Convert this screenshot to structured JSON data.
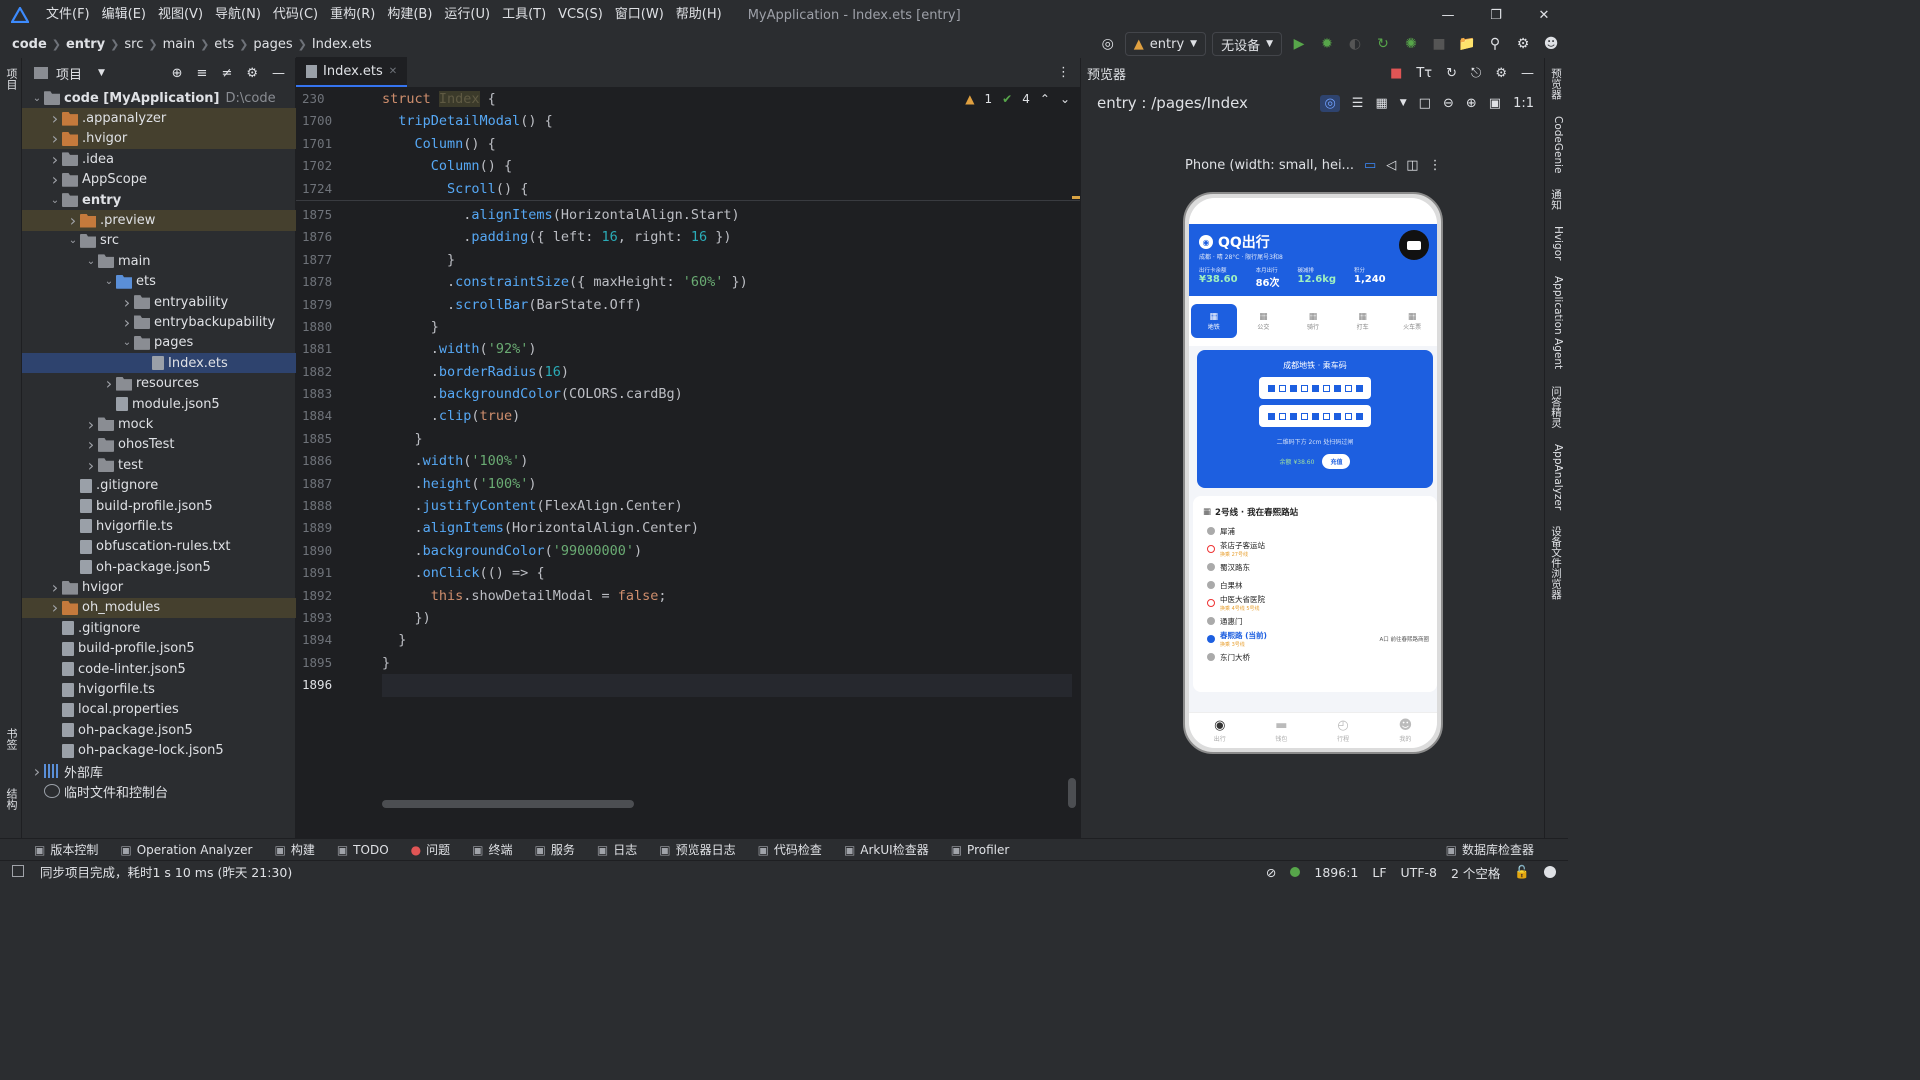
{
  "menubar": {
    "items": [
      "文件(F)",
      "编辑(E)",
      "视图(V)",
      "导航(N)",
      "代码(C)",
      "重构(R)",
      "构建(B)",
      "运行(U)",
      "工具(T)",
      "VCS(S)",
      "窗口(W)",
      "帮助(H)"
    ],
    "title": "MyApplication - Index.ets [entry]"
  },
  "breadcrumb": [
    "code",
    "entry",
    "src",
    "main",
    "ets",
    "pages",
    "Index.ets"
  ],
  "toolbar": {
    "run_config": "entry",
    "device": "无设备"
  },
  "left_strip": {
    "project": "项目",
    "bookmarks": "书签",
    "structure": "结构"
  },
  "project_panel": {
    "title": "项目",
    "tree": [
      {
        "depth": 0,
        "arrow": "down",
        "icon": "folder",
        "label": "code [MyApplication]",
        "extra": "D:\\code",
        "bold": true
      },
      {
        "depth": 1,
        "arrow": "right",
        "icon": "folder-orange",
        "label": ".appanalyzer",
        "hl": true
      },
      {
        "depth": 1,
        "arrow": "right",
        "icon": "folder-orange",
        "label": ".hvigor",
        "hl": true
      },
      {
        "depth": 1,
        "arrow": "right",
        "icon": "folder",
        "label": ".idea"
      },
      {
        "depth": 1,
        "arrow": "right",
        "icon": "folder",
        "label": "AppScope"
      },
      {
        "depth": 1,
        "arrow": "down",
        "icon": "folder",
        "label": "entry",
        "bold": true
      },
      {
        "depth": 2,
        "arrow": "right",
        "icon": "folder-orange",
        "label": ".preview",
        "hl": true
      },
      {
        "depth": 2,
        "arrow": "down",
        "icon": "folder",
        "label": "src"
      },
      {
        "depth": 3,
        "arrow": "down",
        "icon": "folder",
        "label": "main"
      },
      {
        "depth": 4,
        "arrow": "down",
        "icon": "folder-blue",
        "label": "ets"
      },
      {
        "depth": 5,
        "arrow": "right",
        "icon": "folder",
        "label": "entryability"
      },
      {
        "depth": 5,
        "arrow": "right",
        "icon": "folder",
        "label": "entrybackupability"
      },
      {
        "depth": 5,
        "arrow": "down",
        "icon": "folder",
        "label": "pages"
      },
      {
        "depth": 6,
        "arrow": "",
        "icon": "file",
        "label": "Index.ets",
        "sel": true
      },
      {
        "depth": 4,
        "arrow": "right",
        "icon": "folder",
        "label": "resources"
      },
      {
        "depth": 4,
        "arrow": "",
        "icon": "file",
        "label": "module.json5"
      },
      {
        "depth": 3,
        "arrow": "right",
        "icon": "folder",
        "label": "mock"
      },
      {
        "depth": 3,
        "arrow": "right",
        "icon": "folder",
        "label": "ohosTest"
      },
      {
        "depth": 3,
        "arrow": "right",
        "icon": "folder",
        "label": "test"
      },
      {
        "depth": 2,
        "arrow": "",
        "icon": "file",
        "label": ".gitignore"
      },
      {
        "depth": 2,
        "arrow": "",
        "icon": "file",
        "label": "build-profile.json5"
      },
      {
        "depth": 2,
        "arrow": "",
        "icon": "file",
        "label": "hvigorfile.ts"
      },
      {
        "depth": 2,
        "arrow": "",
        "icon": "file",
        "label": "obfuscation-rules.txt"
      },
      {
        "depth": 2,
        "arrow": "",
        "icon": "file",
        "label": "oh-package.json5"
      },
      {
        "depth": 1,
        "arrow": "right",
        "icon": "folder",
        "label": "hvigor"
      },
      {
        "depth": 1,
        "arrow": "right",
        "icon": "folder-orange",
        "label": "oh_modules",
        "hl": true
      },
      {
        "depth": 1,
        "arrow": "",
        "icon": "file",
        "label": ".gitignore"
      },
      {
        "depth": 1,
        "arrow": "",
        "icon": "file",
        "label": "build-profile.json5"
      },
      {
        "depth": 1,
        "arrow": "",
        "icon": "file",
        "label": "code-linter.json5"
      },
      {
        "depth": 1,
        "arrow": "",
        "icon": "file",
        "label": "hvigorfile.ts"
      },
      {
        "depth": 1,
        "arrow": "",
        "icon": "file",
        "label": "local.properties"
      },
      {
        "depth": 1,
        "arrow": "",
        "icon": "file",
        "label": "oh-package.json5"
      },
      {
        "depth": 1,
        "arrow": "",
        "icon": "file",
        "label": "oh-package-lock.json5"
      },
      {
        "depth": 0,
        "arrow": "right",
        "icon": "lib",
        "label": "外部库"
      },
      {
        "depth": 0,
        "arrow": "",
        "icon": "scratch",
        "label": "临时文件和控制台"
      }
    ]
  },
  "editor": {
    "tab": "Index.ets",
    "inspections": {
      "warnings": "1",
      "ok": "4"
    },
    "lines": [
      {
        "n": "230",
        "code": [
          [
            "kw",
            "struct "
          ],
          [
            "cls",
            "Index"
          ],
          [
            "punc",
            " {"
          ]
        ]
      },
      {
        "n": "1700",
        "code": [
          [
            "punc",
            "  "
          ],
          [
            "fn",
            "tripDetailModal"
          ],
          [
            "punc",
            "() {"
          ]
        ]
      },
      {
        "n": "1701",
        "code": [
          [
            "punc",
            "    "
          ],
          [
            "fn",
            "Column"
          ],
          [
            "punc",
            "() {"
          ]
        ]
      },
      {
        "n": "1702",
        "code": [
          [
            "punc",
            "      "
          ],
          [
            "fn",
            "Column"
          ],
          [
            "punc",
            "() {"
          ]
        ]
      },
      {
        "n": "1724",
        "code": [
          [
            "punc",
            "        "
          ],
          [
            "fn",
            "Scroll"
          ],
          [
            "punc",
            "() {"
          ]
        ]
      },
      {
        "n": "1875",
        "code": [
          [
            "punc",
            "          ."
          ],
          [
            "fn",
            "alignItems"
          ],
          [
            "punc",
            "(HorizontalAlign.Start)"
          ]
        ]
      },
      {
        "n": "1876",
        "code": [
          [
            "punc",
            "          ."
          ],
          [
            "fn",
            "padding"
          ],
          [
            "punc",
            "({ left: "
          ],
          [
            "num",
            "16"
          ],
          [
            "punc",
            ", right: "
          ],
          [
            "num",
            "16"
          ],
          [
            "punc",
            " })"
          ]
        ]
      },
      {
        "n": "1877",
        "code": [
          [
            "punc",
            "        }"
          ]
        ]
      },
      {
        "n": "1878",
        "code": [
          [
            "punc",
            "        ."
          ],
          [
            "fn",
            "constraintSize"
          ],
          [
            "punc",
            "({ maxHeight: "
          ],
          [
            "str",
            "'60%'"
          ],
          [
            "punc",
            " })"
          ]
        ]
      },
      {
        "n": "1879",
        "code": [
          [
            "punc",
            "        ."
          ],
          [
            "fn",
            "scrollBar"
          ],
          [
            "punc",
            "(BarState.Off)"
          ]
        ]
      },
      {
        "n": "1880",
        "code": [
          [
            "punc",
            "      }"
          ]
        ]
      },
      {
        "n": "1881",
        "code": [
          [
            "punc",
            "      ."
          ],
          [
            "fn",
            "width"
          ],
          [
            "punc",
            "("
          ],
          [
            "str",
            "'92%'"
          ],
          [
            "punc",
            ")"
          ]
        ]
      },
      {
        "n": "1882",
        "code": [
          [
            "punc",
            "      ."
          ],
          [
            "fn",
            "borderRadius"
          ],
          [
            "punc",
            "("
          ],
          [
            "num",
            "16"
          ],
          [
            "punc",
            ")"
          ]
        ]
      },
      {
        "n": "1883",
        "code": [
          [
            "punc",
            "      ."
          ],
          [
            "fn",
            "backgroundColor"
          ],
          [
            "punc",
            "(COLORS.cardBg)"
          ]
        ]
      },
      {
        "n": "1884",
        "code": [
          [
            "punc",
            "      ."
          ],
          [
            "fn",
            "clip"
          ],
          [
            "punc",
            "("
          ],
          [
            "kw",
            "true"
          ],
          [
            "punc",
            ")"
          ]
        ]
      },
      {
        "n": "1885",
        "code": [
          [
            "punc",
            "    }"
          ]
        ]
      },
      {
        "n": "1886",
        "code": [
          [
            "punc",
            "    ."
          ],
          [
            "fn",
            "width"
          ],
          [
            "punc",
            "("
          ],
          [
            "str",
            "'100%'"
          ],
          [
            "punc",
            ")"
          ]
        ]
      },
      {
        "n": "1887",
        "code": [
          [
            "punc",
            "    ."
          ],
          [
            "fn",
            "height"
          ],
          [
            "punc",
            "("
          ],
          [
            "str",
            "'100%'"
          ],
          [
            "punc",
            ")"
          ]
        ]
      },
      {
        "n": "1888",
        "code": [
          [
            "punc",
            "    ."
          ],
          [
            "fn",
            "justifyContent"
          ],
          [
            "punc",
            "(FlexAlign.Center)"
          ]
        ]
      },
      {
        "n": "1889",
        "code": [
          [
            "punc",
            "    ."
          ],
          [
            "fn",
            "alignItems"
          ],
          [
            "punc",
            "(HorizontalAlign.Center)"
          ]
        ]
      },
      {
        "n": "1890",
        "code": [
          [
            "punc",
            "    ."
          ],
          [
            "fn",
            "backgroundColor"
          ],
          [
            "punc",
            "("
          ],
          [
            "str",
            "'99000000'"
          ],
          [
            "punc",
            ")"
          ]
        ]
      },
      {
        "n": "1891",
        "code": [
          [
            "punc",
            "    ."
          ],
          [
            "fn",
            "onClick"
          ],
          [
            "punc",
            "(() => {"
          ]
        ]
      },
      {
        "n": "1892",
        "code": [
          [
            "punc",
            "      "
          ],
          [
            "kw",
            "this"
          ],
          [
            "punc",
            ".showDetailModal = "
          ],
          [
            "kw",
            "false"
          ],
          [
            "punc",
            ";"
          ]
        ]
      },
      {
        "n": "1893",
        "code": [
          [
            "punc",
            "    })"
          ]
        ]
      },
      {
        "n": "1894",
        "code": [
          [
            "punc",
            "  }"
          ]
        ]
      },
      {
        "n": "1895",
        "code": [
          [
            "punc",
            "}"
          ]
        ]
      },
      {
        "n": "1896",
        "code": [],
        "current": true
      }
    ]
  },
  "previewer": {
    "title": "预览器",
    "path": "entry : /pages/Index",
    "device": "Phone (width: small, hei...",
    "app": {
      "name": "QQ出行",
      "sub": "成都 · 晴 28°C · 限行尾号3和8",
      "stats": [
        {
          "label": "出行卡余额",
          "value": "¥38.60"
        },
        {
          "label": "本月出行",
          "value": "86次"
        },
        {
          "label": "碳减排",
          "value": "12.6kg"
        },
        {
          "label": "积分",
          "value": "1,240"
        }
      ],
      "tabs": [
        "地铁",
        "公交",
        "骑行",
        "打车",
        "火车票"
      ],
      "card_title": "成都地铁 · 乘车码",
      "card_hint": "二维码下方 2cm 处扫码过闸",
      "card_balance": "余额 ¥38.60",
      "card_btn": "充值",
      "line_title": "2号线 · 我在春熙路站",
      "stations": [
        {
          "name": "犀浦",
          "type": "grey"
        },
        {
          "name": "茶店子客运站",
          "sub": "换乘 27号线",
          "type": "red"
        },
        {
          "name": "蜀汉路东",
          "type": "grey"
        },
        {
          "name": "白果林",
          "type": "grey"
        },
        {
          "name": "中医大省医院",
          "sub": "换乘 4号线 5号线",
          "type": "red"
        },
        {
          "name": "通惠门",
          "type": "grey"
        },
        {
          "name": "春熙路 (当前)",
          "sub": "换乘 3号线",
          "type": "blue",
          "right": "A口  前往春熙路商圈"
        },
        {
          "name": "东门大桥",
          "type": "grey"
        }
      ],
      "nav": [
        "出行",
        "钱包",
        "行程",
        "我的"
      ]
    }
  },
  "right_strip": [
    "预览器",
    "CodeGenie",
    "通知",
    "Hvigor",
    "Application Agent",
    "问答精灵",
    "AppAnalyzer",
    "设备文件浏览器"
  ],
  "toolwindows": [
    "版本控制",
    "Operation Analyzer",
    "构建",
    "TODO",
    "问题",
    "终端",
    "服务",
    "日志",
    "预览器日志",
    "代码检查",
    "ArkUI检查器",
    "Profiler",
    "数据库检查器"
  ],
  "status": {
    "message": "同步项目完成，耗时1 s 10 ms (昨天 21:30)",
    "position": "1896:1",
    "eol": "LF",
    "encoding": "UTF-8",
    "indent": "2 个空格"
  }
}
